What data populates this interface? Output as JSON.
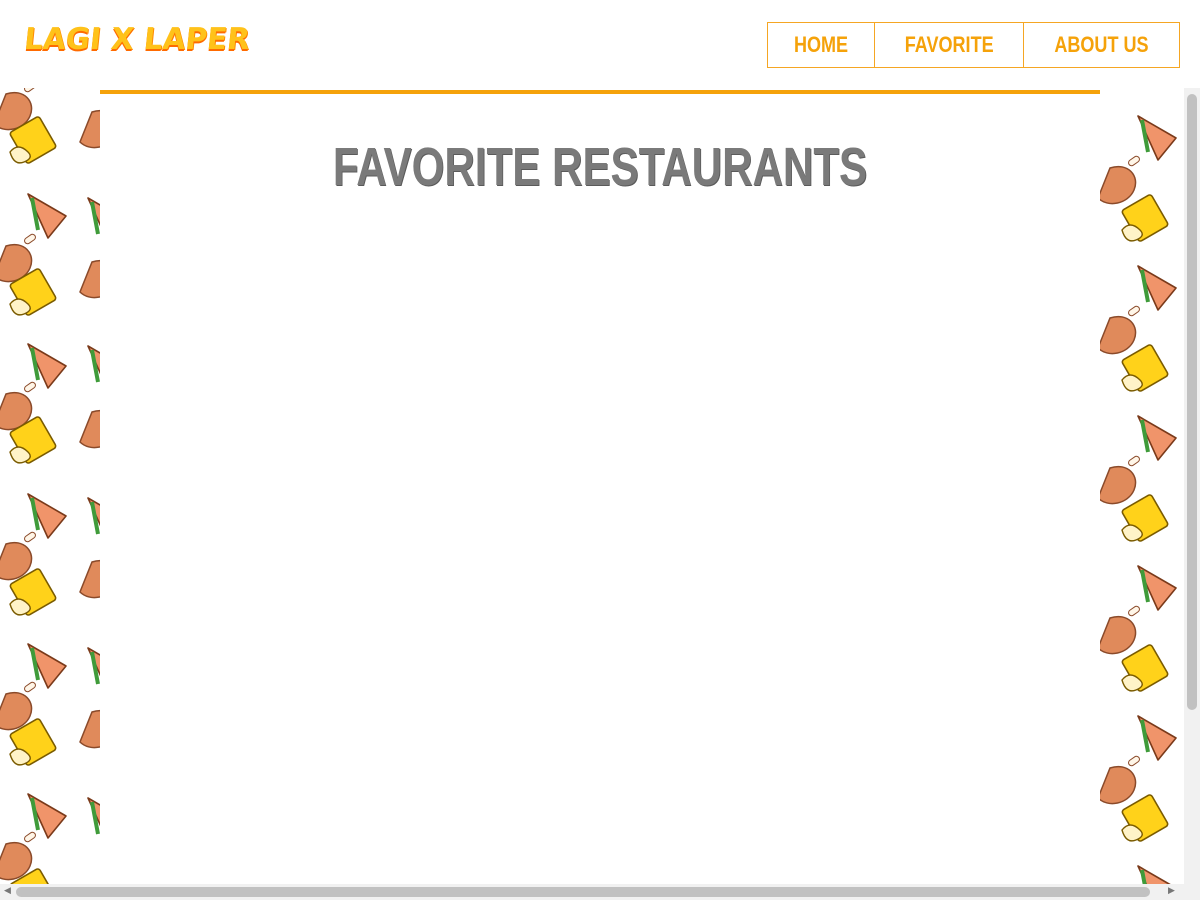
{
  "header": {
    "logo_text": "LAGI X LAPER",
    "nav": [
      {
        "label": "HOME"
      },
      {
        "label": "FAVORITE"
      },
      {
        "label": "ABOUT US"
      }
    ]
  },
  "main": {
    "title": "FAVORITE RESTAURANTS"
  },
  "colors": {
    "accent": "#f5a20a",
    "title": "#7a7a7a",
    "background": "#ffffff"
  },
  "pattern_icons": [
    "chicken-leg-icon",
    "beer-mug-icon",
    "sandwich-icon"
  ]
}
